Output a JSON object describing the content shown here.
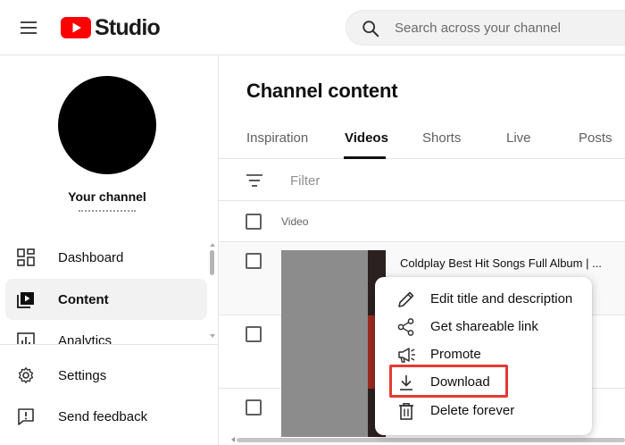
{
  "header": {
    "logo_text": "Studio",
    "search_placeholder": "Search across your channel"
  },
  "sidebar": {
    "channel_label": "Your channel",
    "items": [
      {
        "label": "Dashboard",
        "icon": "dashboard-icon"
      },
      {
        "label": "Content",
        "icon": "content-icon",
        "active": true
      },
      {
        "label": "Analytics",
        "icon": "analytics-icon"
      },
      {
        "label": "Settings",
        "icon": "gear-icon"
      },
      {
        "label": "Send feedback",
        "icon": "feedback-icon"
      }
    ]
  },
  "main": {
    "title": "Channel content",
    "tabs": [
      {
        "label": "Inspiration"
      },
      {
        "label": "Videos",
        "active": true
      },
      {
        "label": "Shorts"
      },
      {
        "label": "Live"
      },
      {
        "label": "Posts"
      }
    ],
    "filter_placeholder": "Filter",
    "column_video": "Video",
    "rows": [
      {
        "title": "Coldplay Best Hit Songs Full Album | ..."
      },
      {
        "title": ""
      },
      {
        "title": ""
      }
    ]
  },
  "context_menu": {
    "items": [
      {
        "label": "Edit title and description",
        "icon": "pencil-icon"
      },
      {
        "label": "Get shareable link",
        "icon": "share-icon"
      },
      {
        "label": "Promote",
        "icon": "megaphone-icon"
      },
      {
        "label": "Download",
        "icon": "download-icon",
        "highlighted": true
      },
      {
        "label": "Delete forever",
        "icon": "trash-icon"
      }
    ]
  },
  "colors": {
    "brand_red": "#ff0000",
    "highlight_border": "#e53935",
    "active_bg": "#f2f2f2"
  }
}
